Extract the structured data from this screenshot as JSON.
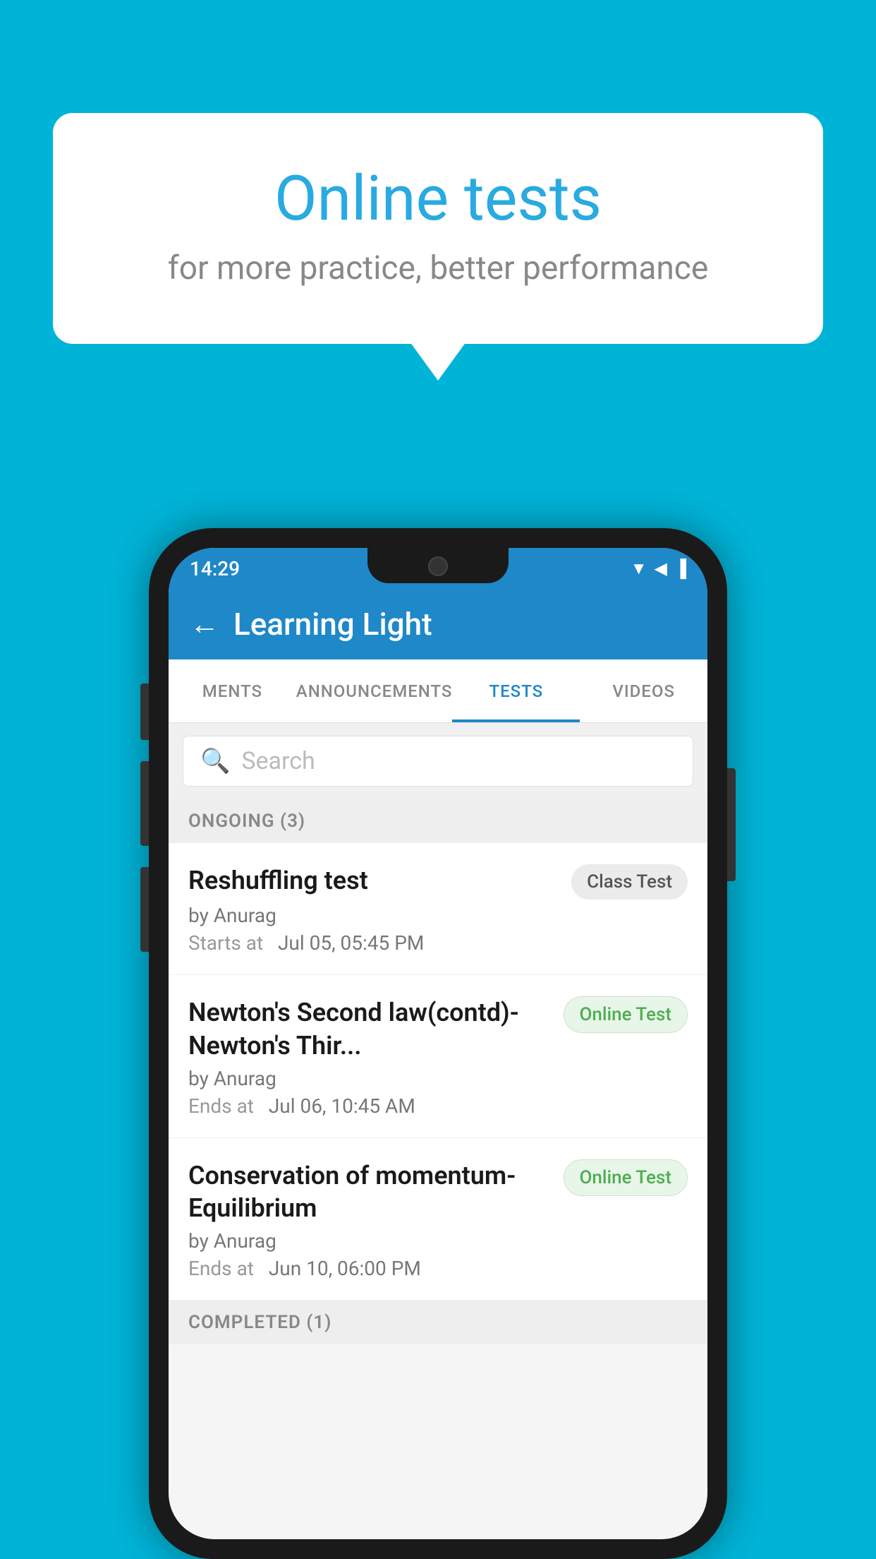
{
  "background_color": "#00b4d8",
  "bubble": {
    "title": "Online tests",
    "subtitle": "for more practice, better performance"
  },
  "phone": {
    "status_bar": {
      "time": "14:29",
      "icons": "▼◀▐"
    },
    "app_bar": {
      "back_icon": "←",
      "title": "Learning Light"
    },
    "tabs": [
      {
        "label": "MENTS",
        "active": false
      },
      {
        "label": "ANNOUNCEMENTS",
        "active": false
      },
      {
        "label": "TESTS",
        "active": true
      },
      {
        "label": "VIDEOS",
        "active": false
      }
    ],
    "search": {
      "placeholder": "Search",
      "icon": "🔍"
    },
    "ongoing_section": {
      "label": "ONGOING (3)",
      "items": [
        {
          "name": "Reshuffling test",
          "badge": "Class Test",
          "badge_type": "class",
          "by": "by Anurag",
          "time_label": "Starts at",
          "time_value": "Jul 05, 05:45 PM"
        },
        {
          "name": "Newton's Second law(contd)-Newton's Thir...",
          "badge": "Online Test",
          "badge_type": "online",
          "by": "by Anurag",
          "time_label": "Ends at",
          "time_value": "Jul 06, 10:45 AM"
        },
        {
          "name": "Conservation of momentum-Equilibrium",
          "badge": "Online Test",
          "badge_type": "online",
          "by": "by Anurag",
          "time_label": "Ends at",
          "time_value": "Jun 10, 06:00 PM"
        }
      ]
    },
    "completed_section": {
      "label": "COMPLETED (1)"
    }
  }
}
